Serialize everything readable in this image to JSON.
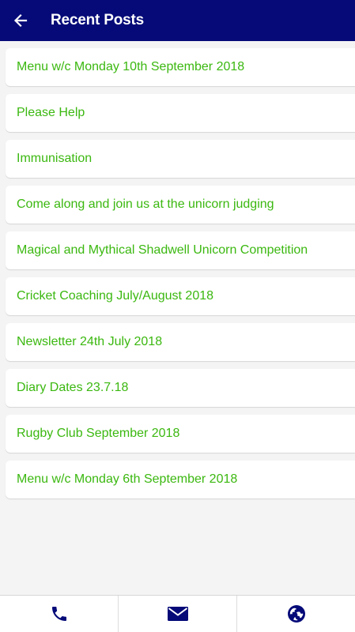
{
  "header": {
    "title": "Recent Posts",
    "back_icon": "arrow-left-icon",
    "background": "#050a78"
  },
  "posts": [
    {
      "title": "Menu w/c Monday 10th September 2018"
    },
    {
      "title": "Please Help"
    },
    {
      "title": "Immunisation"
    },
    {
      "title": "Come along and join us at the unicorn judging"
    },
    {
      "title": "Magical and Mythical Shadwell Unicorn Competition"
    },
    {
      "title": "Cricket Coaching July/August 2018"
    },
    {
      "title": "Newsletter 24th July 2018"
    },
    {
      "title": "Diary Dates 23.7.18"
    },
    {
      "title": "Rugby Club September 2018"
    },
    {
      "title": "Menu w/c Monday 6th September 2018"
    }
  ],
  "tab_bar": {
    "items": [
      {
        "icon": "phone-icon"
      },
      {
        "icon": "envelope-icon"
      },
      {
        "icon": "globe-icon"
      }
    ],
    "icon_color": "#050a78"
  },
  "colors": {
    "post_text": "#3bb810",
    "page_background": "#f4f4f4"
  }
}
